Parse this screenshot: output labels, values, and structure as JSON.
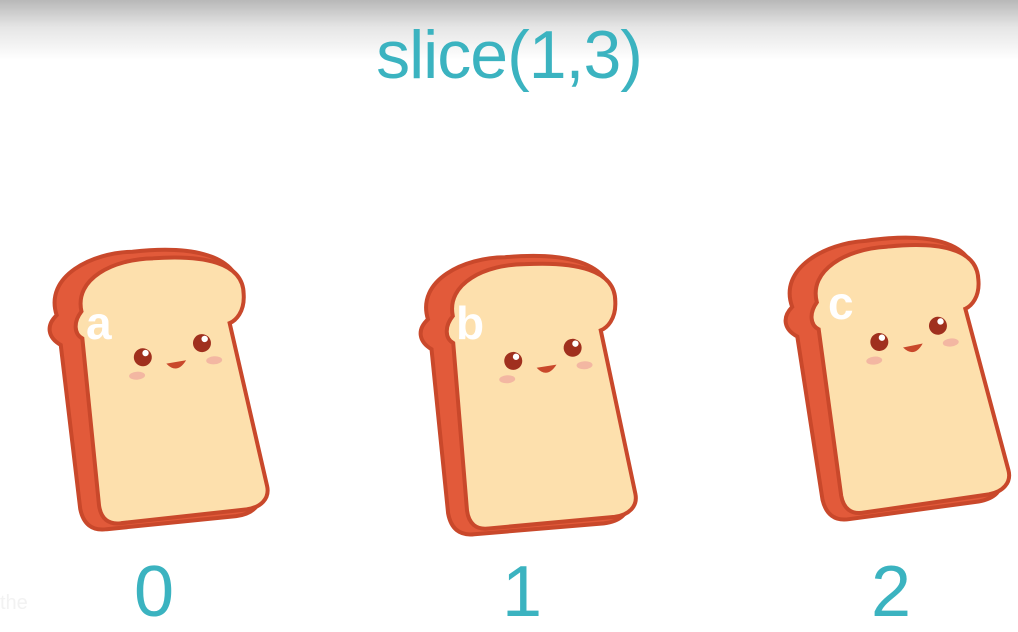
{
  "title": "slice(1,3)",
  "items": [
    {
      "letter": "a",
      "index": "0"
    },
    {
      "letter": "b",
      "index": "1"
    },
    {
      "letter": "c",
      "index": "2"
    }
  ],
  "caption_fragment": "the",
  "colors": {
    "accent": "#3bb3c0",
    "crust": "#e25a3a",
    "crust_dark": "#d8492c",
    "bread": "#fde0ad",
    "outline": "#c9482b",
    "blush": "#f3b7a2"
  },
  "icons": [
    "toast-icon",
    "toast-icon",
    "toast-icon"
  ]
}
